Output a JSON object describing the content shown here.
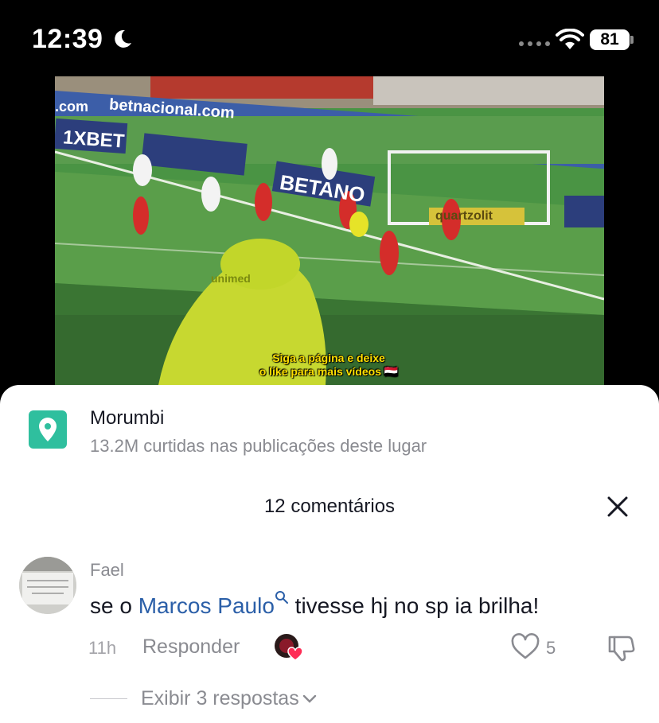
{
  "status": {
    "time": "12:39",
    "battery": "81",
    "icons": [
      "moon-icon",
      "signal-dots-icon",
      "wifi-icon",
      "battery-icon"
    ]
  },
  "video": {
    "caption_line1": "Siga a página e deixe",
    "caption_line2": "o like para mais vídeos 🇾🇪",
    "banner_text_1": "betnacional.com",
    "banner_text_2": "1XBET",
    "banner_text_3": "BETANO",
    "banner_text_4": "quartzolit",
    "shirt_text": "unimed",
    "side_text": ".com"
  },
  "place": {
    "name": "Morumbi",
    "stats": "13.2M curtidas nas publicações deste lugar",
    "icon": "location-pin-icon",
    "accent": "#2fbf9e"
  },
  "comments": {
    "title": "12 comentários",
    "close_icon": "close-icon",
    "items": [
      {
        "username": "Fael",
        "text_before": "se o ",
        "mention": "Marcos Paulo",
        "text_after": " tivesse hj no sp ia brilha!",
        "timestamp": "11h",
        "reply_label": "Responder",
        "like_count": "5",
        "view_replies": "Exibir 3 respostas",
        "avatar_text": "ELE É O CAMINHO A VERDADE E A VIDA"
      }
    ]
  },
  "colors": {
    "mention": "#2b5fa8",
    "text_primary": "#161823",
    "text_secondary": "#8a8b91",
    "creator_heart": "#fe2c55"
  }
}
